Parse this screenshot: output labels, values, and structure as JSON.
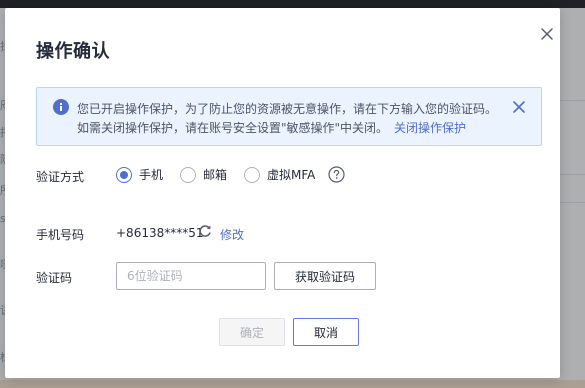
{
  "dialog": {
    "title": "操作确认",
    "close_icon": "close-icon"
  },
  "alert": {
    "icon": "info-icon",
    "line1": "您已开启操作保护，为了防止您的资源被无意操作，请在下方输入您的验证码。",
    "line2": "如需关闭操作保护，请在账号安全设置\"敏感操作\"中关闭。",
    "link": "关闭操作保护",
    "close_icon": "close-icon",
    "accent_color": "#526ecc",
    "background_color": "#eaf3fe"
  },
  "verify_method": {
    "label": "验证方式",
    "options": [
      {
        "label": "手机",
        "checked": true
      },
      {
        "label": "邮箱",
        "checked": false
      },
      {
        "label": "虚拟MFA",
        "checked": false
      }
    ],
    "help_icon": "question-circle-icon"
  },
  "phone": {
    "label": "手机号码",
    "value": "+86138****51",
    "refresh_icon": "refresh-icon",
    "modify_link": "修改"
  },
  "code": {
    "label": "验证码",
    "placeholder": "6位验证码",
    "value": "",
    "get_code_button": "获取验证码"
  },
  "footer": {
    "confirm_button": "确定",
    "confirm_disabled": true,
    "cancel_button": "取消"
  },
  "background": {
    "glyphs": [
      "揖",
      "咫",
      "捋",
      "陡",
      "所",
      "s",
      "哒",
      "诀",
      "标"
    ]
  }
}
